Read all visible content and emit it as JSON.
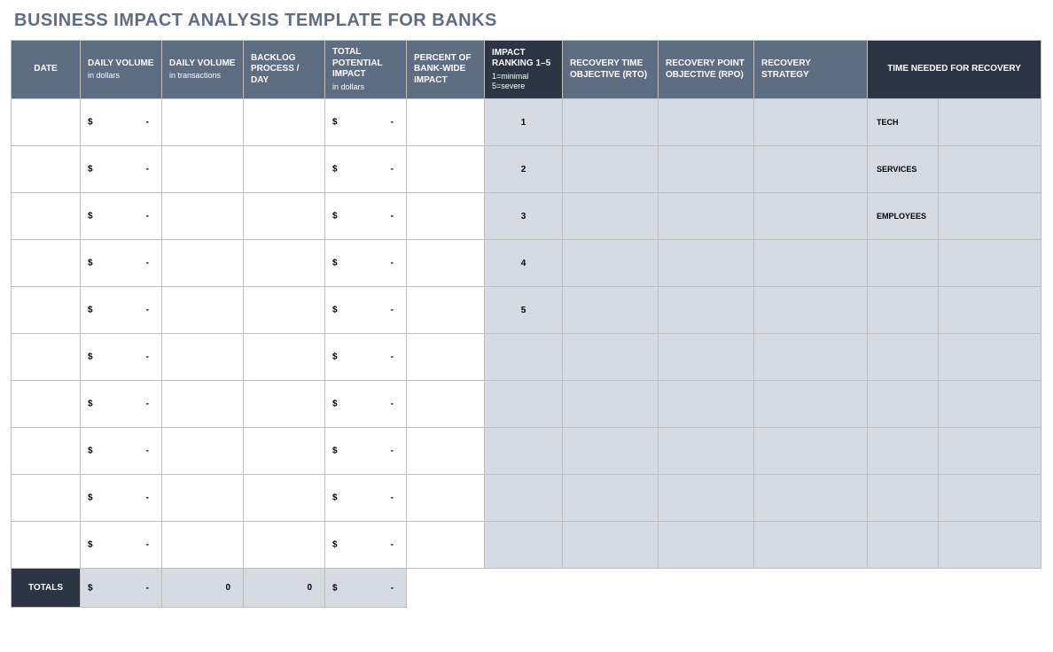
{
  "title": "BUSINESS IMPACT ANALYSIS TEMPLATE FOR BANKS",
  "columns": {
    "date": {
      "label": "DATE"
    },
    "daily_volume_dollars": {
      "label": "DAILY VOLUME",
      "sub": "in dollars"
    },
    "daily_volume_transactions": {
      "label": "DAILY VOLUME",
      "sub": "in transactions"
    },
    "backlog": {
      "label": "BACKLOG PROCESS / DAY"
    },
    "total_potential_impact": {
      "label": "TOTAL POTENTIAL IMPACT",
      "sub": "in dollars"
    },
    "percent_bankwide": {
      "label": "PERCENT OF BANK-WIDE IMPACT"
    },
    "impact_ranking": {
      "label": "IMPACT RANKING 1–5",
      "sub": "1=minimal 5=severe"
    },
    "rto": {
      "label": "RECOVERY TIME OBJECTIVE (RTO)"
    },
    "rpo": {
      "label": "RECOVERY POINT OBJECTIVE (RPO)"
    },
    "recovery_strategy": {
      "label": "RECOVERY STRATEGY"
    },
    "time_needed": {
      "label": "TIME NEEDED FOR RECOVERY"
    }
  },
  "currency_symbol": "$",
  "empty_value": "-",
  "rows": [
    {
      "daily_volume_dollars": "-",
      "total_potential_impact": "-",
      "impact_ranking": "1",
      "recovery_label": "TECH"
    },
    {
      "daily_volume_dollars": "-",
      "total_potential_impact": "-",
      "impact_ranking": "2",
      "recovery_label": "SERVICES"
    },
    {
      "daily_volume_dollars": "-",
      "total_potential_impact": "-",
      "impact_ranking": "3",
      "recovery_label": "EMPLOYEES"
    },
    {
      "daily_volume_dollars": "-",
      "total_potential_impact": "-",
      "impact_ranking": "4",
      "recovery_label": ""
    },
    {
      "daily_volume_dollars": "-",
      "total_potential_impact": "-",
      "impact_ranking": "5",
      "recovery_label": ""
    },
    {
      "daily_volume_dollars": "-",
      "total_potential_impact": "-",
      "impact_ranking": "",
      "recovery_label": ""
    },
    {
      "daily_volume_dollars": "-",
      "total_potential_impact": "-",
      "impact_ranking": "",
      "recovery_label": ""
    },
    {
      "daily_volume_dollars": "-",
      "total_potential_impact": "-",
      "impact_ranking": "",
      "recovery_label": ""
    },
    {
      "daily_volume_dollars": "-",
      "total_potential_impact": "-",
      "impact_ranking": "",
      "recovery_label": ""
    },
    {
      "daily_volume_dollars": "-",
      "total_potential_impact": "-",
      "impact_ranking": "",
      "recovery_label": ""
    }
  ],
  "totals": {
    "label": "TOTALS",
    "daily_volume_dollars": "-",
    "daily_volume_transactions": "0",
    "backlog": "0",
    "total_potential_impact": "-"
  }
}
